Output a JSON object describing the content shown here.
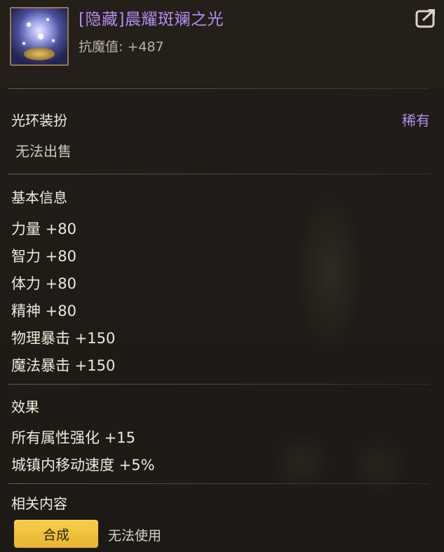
{
  "item": {
    "name": "[隐藏]晨耀斑斓之光",
    "stat_line": "抗魔值: +487",
    "icon": "aura-orb-icon"
  },
  "category": {
    "type": "光环装扮",
    "rarity": "稀有",
    "sell_status": "无法出售"
  },
  "basic_info": {
    "title": "基本信息",
    "stats": [
      "力量 +80",
      "智力 +80",
      "体力 +80",
      "精神 +80",
      "物理暴击 +150",
      "魔法暴击 +150"
    ]
  },
  "effects": {
    "title": "效果",
    "items": [
      "所有属性强化 +15",
      "城镇内移动速度 +5%"
    ]
  },
  "related": {
    "title": "相关内容",
    "synth_button": "合成",
    "usage_status": "无法使用"
  },
  "colors": {
    "rare_purple": "#b48cf0",
    "button_gold": "#f0c23e"
  }
}
